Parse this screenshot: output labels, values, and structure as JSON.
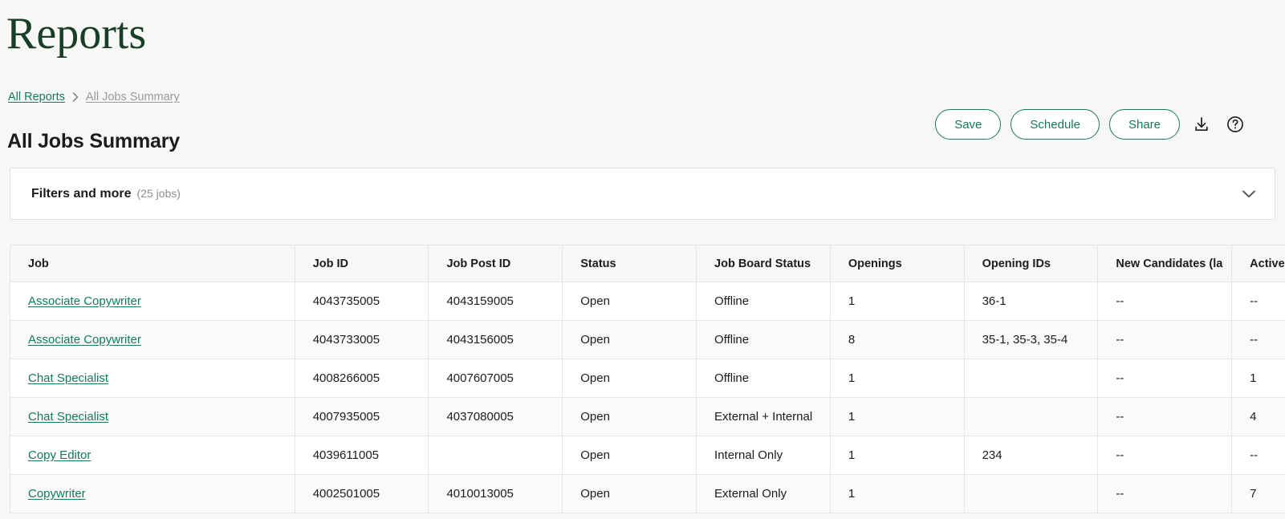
{
  "app": {
    "title": "Reports"
  },
  "breadcrumb": {
    "root_label": "All Reports",
    "separator": "›",
    "current_label": "All Jobs Summary"
  },
  "header": {
    "page_title": "All Jobs Summary",
    "actions": {
      "save_label": "Save",
      "schedule_label": "Schedule",
      "share_label": "Share",
      "download_icon": "download-icon",
      "help_icon": "help-circle-icon"
    }
  },
  "filters": {
    "title": "Filters and more",
    "count_label": "(25 jobs)",
    "chevron_icon": "chevron-down-icon"
  },
  "table": {
    "columns": [
      "Job",
      "Job ID",
      "Job Post ID",
      "Status",
      "Job Board Status",
      "Openings",
      "Opening IDs",
      "New Candidates (la",
      "Active Cand"
    ],
    "rows": [
      {
        "job": "Associate Copywriter",
        "job_id": "4043735005",
        "job_post_id": "4043159005",
        "status": "Open",
        "job_board_status": "Offline",
        "openings": "1",
        "opening_ids": "36-1",
        "new_candidates": "--",
        "active_candidates": "--"
      },
      {
        "job": "Associate Copywriter",
        "job_id": "4043733005",
        "job_post_id": "4043156005",
        "status": "Open",
        "job_board_status": "Offline",
        "openings": "8",
        "opening_ids": "35-1, 35-3, 35-4",
        "new_candidates": "--",
        "active_candidates": "--"
      },
      {
        "job": "Chat Specialist",
        "job_id": "4008266005",
        "job_post_id": "4007607005",
        "status": "Open",
        "job_board_status": "Offline",
        "openings": "1",
        "opening_ids": "",
        "new_candidates": "--",
        "active_candidates": "1"
      },
      {
        "job": "Chat Specialist",
        "job_id": "4007935005",
        "job_post_id": "4037080005",
        "status": "Open",
        "job_board_status": "External + Internal",
        "openings": "1",
        "opening_ids": "",
        "new_candidates": "--",
        "active_candidates": "4"
      },
      {
        "job": "Copy Editor",
        "job_id": "4039611005",
        "job_post_id": "",
        "status": "Open",
        "job_board_status": "Internal Only",
        "openings": "1",
        "opening_ids": "234",
        "new_candidates": "--",
        "active_candidates": "--"
      },
      {
        "job": "Copywriter",
        "job_id": "4002501005",
        "job_post_id": "4010013005",
        "status": "Open",
        "job_board_status": "External Only",
        "openings": "1",
        "opening_ids": "",
        "new_candidates": "--",
        "active_candidates": "7"
      }
    ]
  },
  "colors": {
    "brand_green": "#15795c",
    "title_green": "#183d2b",
    "page_bg": "#f7f7f6",
    "text": "#1c1c1b",
    "muted": "#8d8d8c"
  }
}
